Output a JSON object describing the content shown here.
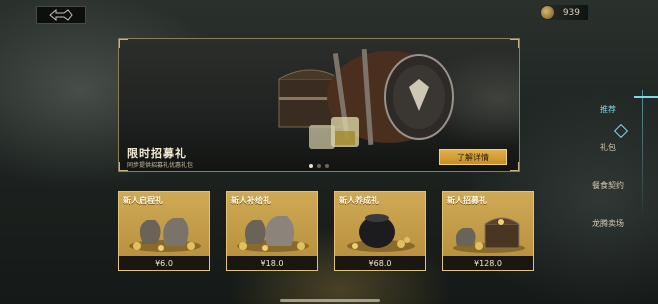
{
  "currency": {
    "icon": "coin-icon",
    "value": "939"
  },
  "banner": {
    "title": "限时招募礼",
    "subtitle": "同步提供招募礼优惠礼包",
    "detail_button": "了解详情",
    "page_count": 3,
    "active_page": 0
  },
  "side_nav": {
    "items": [
      {
        "label": "推荐",
        "active": true
      },
      {
        "label": "礼包",
        "active": false
      },
      {
        "label": "餐食契约",
        "active": false
      },
      {
        "label": "龙腾卖场",
        "active": false
      }
    ]
  },
  "cards": [
    {
      "title": "新人启程礼",
      "price": "¥6.0",
      "art": "coin-sacks-icon"
    },
    {
      "title": "新人补给礼",
      "price": "¥18.0",
      "art": "coin-sacks-icon"
    },
    {
      "title": "新人养成礼",
      "price": "¥68.0",
      "art": "coin-pot-icon"
    },
    {
      "title": "新人招募礼",
      "price": "¥128.0",
      "art": "treasure-chest-icon"
    }
  ],
  "colors": {
    "accent": "#7fd8e8",
    "gold": "#cfa955",
    "button": "#e2b14a"
  }
}
